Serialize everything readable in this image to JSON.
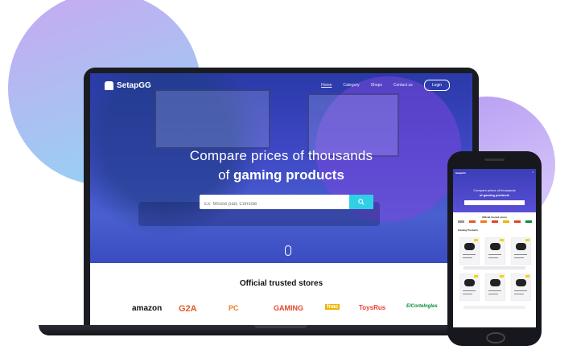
{
  "site": {
    "brand": "SetapGG",
    "nav": [
      "Home",
      "Category",
      "Shops",
      "Contact us"
    ],
    "login": "Login"
  },
  "hero": {
    "line1": "Compare prices of thousands",
    "line2_prefix": "of ",
    "line2_bold": "gaming products",
    "search_placeholder": "Ex: Mouse pad, Console"
  },
  "stores": {
    "title": "Official trusted stores",
    "logos": [
      {
        "name": "amazon",
        "color": "#111111"
      },
      {
        "name": "G2A",
        "color": "#e85a24"
      },
      {
        "name": "PC",
        "color": "#ef7c1a"
      },
      {
        "name": "GAMING",
        "color": "#e4452b"
      },
      {
        "name": "fnac",
        "color": "#f0b400"
      },
      {
        "name": "ToysRus",
        "color": "#e8402c"
      },
      {
        "name": "ElCorteIngles",
        "color": "#0b8a3a"
      }
    ]
  },
  "phone": {
    "brand": "SetapGG",
    "hero_line1": "Compare prices of thousands",
    "hero_line2": "of gaming products",
    "stores_title": "Official trusted stores",
    "section": "Gaming Products"
  },
  "colors": {
    "accent": "#2fd0e6",
    "hero_top": "#2a3aa8",
    "hero_bottom": "#4a5fd0"
  }
}
